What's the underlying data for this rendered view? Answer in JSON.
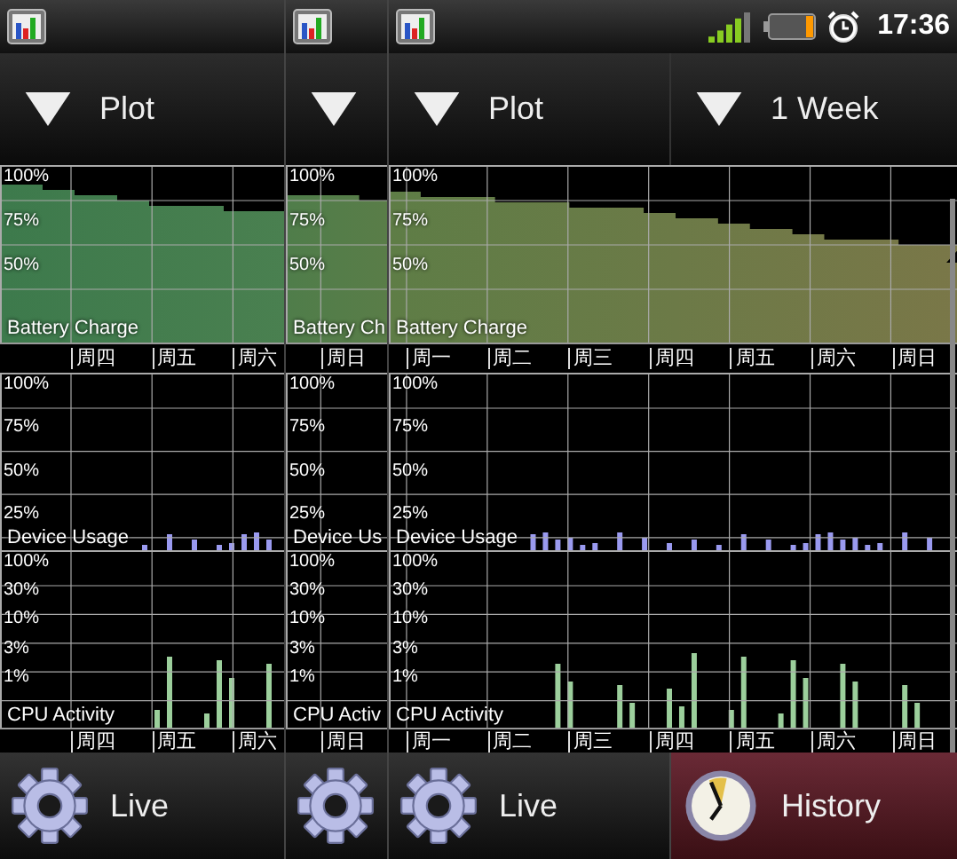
{
  "status_bar": {
    "time": "17:36"
  },
  "panels": [
    {
      "dropdowns": [
        {
          "label": "Plot",
          "icon_only": false
        }
      ],
      "charts": [
        {
          "kind": "battery",
          "title": "Battery Charge",
          "y_labels": [
            "100%",
            "75%",
            "50%"
          ],
          "x_labels": [
            "周四",
            "周五",
            "周六"
          ]
        },
        {
          "kind": "usage",
          "title": "Device Usage",
          "y_labels": [
            "100%",
            "75%",
            "50%",
            "25%"
          ]
        },
        {
          "kind": "cpu",
          "title": "CPU Activity",
          "y_labels": [
            "100%",
            "30%",
            "10%",
            "3%",
            "1%"
          ],
          "x_labels": [
            "周四",
            "周五",
            "周六"
          ]
        }
      ],
      "tabs": [
        {
          "kind": "live",
          "label": "Live",
          "icon_only": false,
          "selected": false
        }
      ]
    },
    {
      "dropdowns": [
        {
          "icon_only": true
        }
      ],
      "charts": [
        {
          "kind": "battery",
          "title": "Battery Ch",
          "y_labels": [
            "100%",
            "75%",
            "50%"
          ],
          "x_labels": [
            "周日"
          ]
        },
        {
          "kind": "usage",
          "title": "Device Us",
          "y_labels": [
            "100%",
            "75%",
            "50%",
            "25%"
          ]
        },
        {
          "kind": "cpu",
          "title": "CPU Activ",
          "y_labels": [
            "100%",
            "30%",
            "10%",
            "3%",
            "1%"
          ],
          "x_labels": [
            "周日"
          ]
        }
      ],
      "tabs": [
        {
          "kind": "live",
          "icon_only": true,
          "selected": false
        }
      ]
    },
    {
      "dropdowns": [
        {
          "label": "Plot",
          "icon_only": false
        },
        {
          "label": "1 Week",
          "icon_only": false
        }
      ],
      "charts": [
        {
          "kind": "battery",
          "title": "Battery Charge",
          "y_labels": [
            "100%",
            "75%",
            "50%"
          ],
          "x_labels": [
            "周一",
            "周二",
            "周三",
            "周四",
            "周五",
            "周六",
            "周日"
          ]
        },
        {
          "kind": "usage",
          "title": "Device Usage",
          "y_labels": [
            "100%",
            "75%",
            "50%",
            "25%"
          ]
        },
        {
          "kind": "cpu",
          "title": "CPU Activity",
          "y_labels": [
            "100%",
            "30%",
            "10%",
            "3%",
            "1%"
          ],
          "x_labels": [
            "周一",
            "周二",
            "周三",
            "周四",
            "周五",
            "周六",
            "周日"
          ]
        }
      ],
      "tabs": [
        {
          "kind": "live",
          "label": "Live",
          "icon_only": false,
          "selected": false
        },
        {
          "kind": "history",
          "label": "History",
          "icon_only": false,
          "selected": true
        }
      ]
    }
  ]
}
